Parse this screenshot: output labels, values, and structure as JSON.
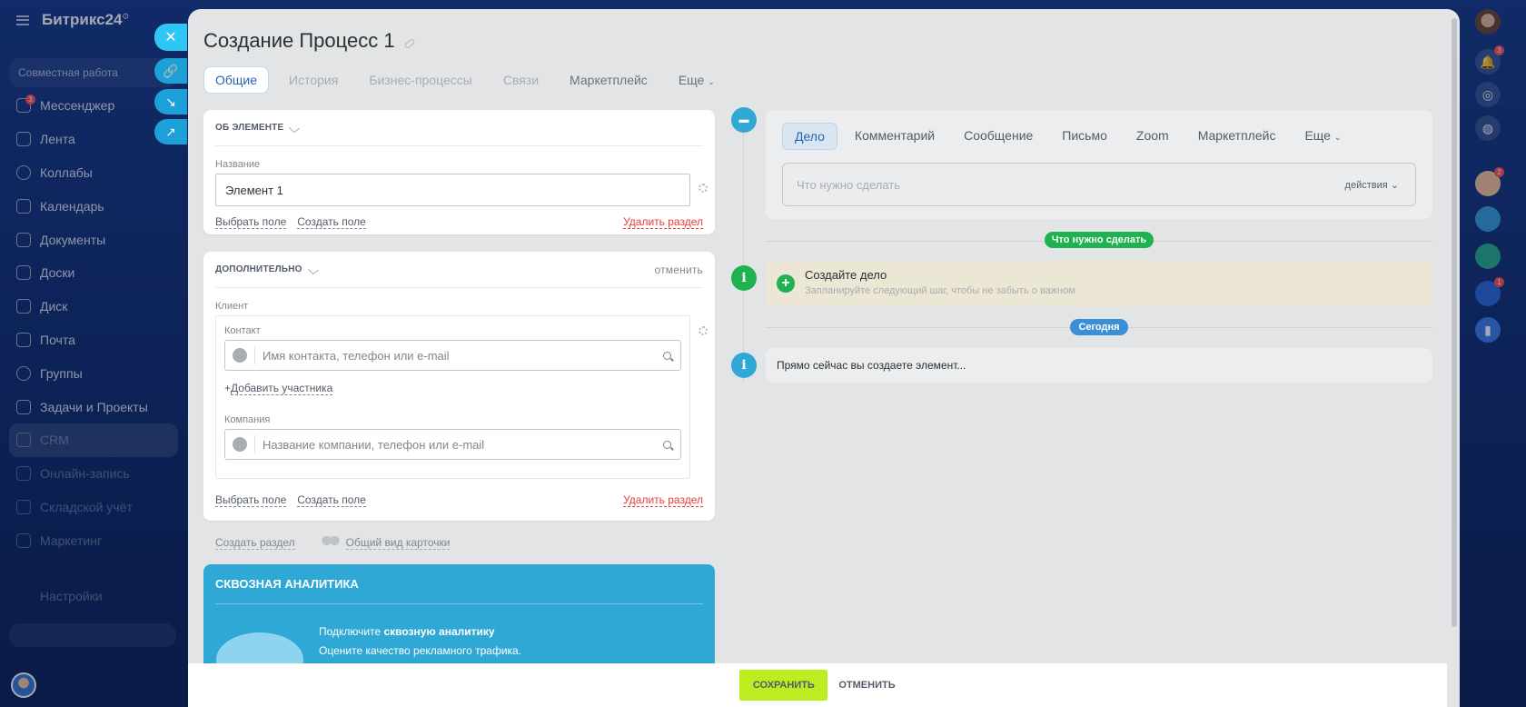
{
  "app": {
    "logo": "Битрикс24"
  },
  "sidebar": {
    "section": "Совместная работа",
    "items": [
      {
        "label": "Мессенджер",
        "badge": "3"
      },
      {
        "label": "Лента"
      },
      {
        "label": "Коллабы"
      },
      {
        "label": "Календарь"
      },
      {
        "label": "Документы"
      },
      {
        "label": "Доски"
      },
      {
        "label": "Диск"
      },
      {
        "label": "Почта"
      },
      {
        "label": "Группы"
      },
      {
        "label": "Задачи и Проекты"
      },
      {
        "label": "CRM"
      },
      {
        "label": "Онлайн-запись"
      },
      {
        "label": "Складской учёт"
      },
      {
        "label": "Маркетинг"
      },
      {
        "label": "Настройки"
      }
    ]
  },
  "rightbar": {
    "notif_badge": "3",
    "chat1_badge": "2",
    "chat2_badge": "1"
  },
  "panel": {
    "title": "Создание Процесс 1",
    "tabs": [
      "Общие",
      "История",
      "Бизнес-процессы",
      "Связи",
      "Маркетплейс",
      "Еще"
    ],
    "about": {
      "head": "ОБ ЭЛЕМЕНТЕ",
      "name_label": "Название",
      "name_value": "Элемент 1",
      "choose_field": "Выбрать поле",
      "create_field": "Создать поле",
      "delete_section": "Удалить раздел"
    },
    "extra": {
      "head": "ДОПОЛНИТЕЛЬНО",
      "cancel": "отменить",
      "client_label": "Клиент",
      "contact_label": "Контакт",
      "contact_placeholder": "Имя контакта, телефон или e-mail",
      "add_participant": "Добавить участника",
      "company_label": "Компания",
      "company_placeholder": "Название компании, телефон или e-mail",
      "choose_field": "Выбрать поле",
      "create_field": "Создать поле",
      "delete_section": "Удалить раздел"
    },
    "create_section": "Создать раздел",
    "common_view": "Общий вид карточки",
    "analytics": {
      "head": "СКВОЗНАЯ АНАЛИТИКА",
      "line1_pre": "Подключите ",
      "line1_bold": "сквозную аналитику",
      "line2": "Оцените качество рекламного трафика."
    }
  },
  "timeline": {
    "editor_tabs": [
      "Дело",
      "Комментарий",
      "Сообщение",
      "Письмо",
      "Zoom",
      "Маркетплейс",
      "Еще"
    ],
    "todo_placeholder": "Что нужно сделать",
    "actions": "действия",
    "pill_todo": "Что нужно сделать",
    "create_title": "Создайте дело",
    "create_sub": "Запланируйте следующий шаг, чтобы не забыть о важном",
    "pill_today": "Сегодня",
    "now_text": "Прямо сейчас вы создаете элемент..."
  },
  "footer": {
    "save": "СОХРАНИТЬ",
    "cancel": "ОТМЕНИТЬ"
  },
  "colors": {
    "accent": "#2fc6f6",
    "save": "#bbed21",
    "green": "#1eb350",
    "info": "#2fa8d6",
    "danger": "#e53d3d"
  }
}
